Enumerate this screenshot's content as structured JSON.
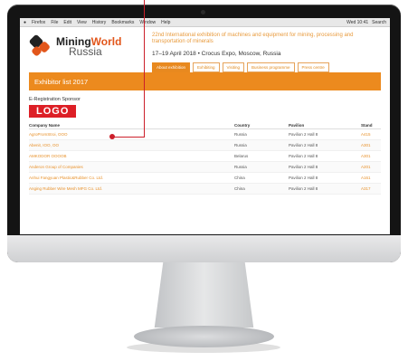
{
  "menubar": {
    "items": [
      "Firefox",
      "File",
      "Edit",
      "View",
      "History",
      "Bookmarks",
      "Window",
      "Help"
    ],
    "right": [
      "Wed 10:41",
      "Search"
    ]
  },
  "brand": {
    "word1": "Mining",
    "word2": "World",
    "word3": "Russia"
  },
  "exhibition_title": "22nd International exhibition of machines and equipment for mining, processing and transportation of minerals",
  "dates": "17–19 April 2018 • Crocus Expo, Moscow, Russia",
  "nav": [
    "About exhibition",
    "Exhibiting",
    "Visiting",
    "Business programme",
    "Press centre"
  ],
  "banner": "Exhibitor list 2017",
  "sponsor_label": "E-Registration Sponsor",
  "logo_text": "LOGO",
  "table": {
    "headers": [
      "Company Name",
      "Country",
      "Pavilion",
      "Stand"
    ],
    "rows": [
      [
        "AgroPromStroi, OOO",
        "Russia",
        "Pavilion 2 Hall 8",
        "A415"
      ],
      [
        "Abenit, IOO, OO",
        "Russia",
        "Pavilion 2 Hall 8",
        "A301"
      ],
      [
        "AMKODOR OOOOB",
        "Belarus",
        "Pavilion 2 Hall 8",
        "A301"
      ],
      [
        "Anderon Group of Companies",
        "Russia",
        "Pavilion 2 Hall 8",
        "A201"
      ],
      [
        "Anhui Fangyuan Plastic&Rubber Co. Ltd.",
        "China",
        "Pavilion 2 Hall 8",
        "A161"
      ],
      [
        "Anging Rubber Wire Mesh MFG Co. Ltd.",
        "China",
        "Pavilion 2 Hall 8",
        "A317"
      ]
    ]
  },
  "colors": {
    "accent": "#ec8a1e",
    "logo_red": "#dd1f26",
    "pointer": "#cc1f2a"
  }
}
